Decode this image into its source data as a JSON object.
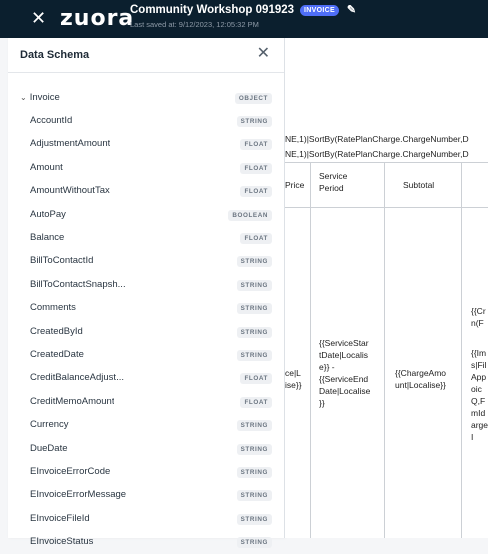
{
  "header": {
    "logo": "zuora",
    "title": "Community Workshop 091923",
    "badge": "INVOICE",
    "saved": "Last saved at: 9/12/2023, 12:05:32 PM"
  },
  "panel": {
    "title": "Data Schema",
    "root": {
      "label": "Invoice",
      "type": "OBJECT"
    },
    "fields": [
      {
        "label": "AccountId",
        "type": "STRING"
      },
      {
        "label": "AdjustmentAmount",
        "type": "FLOAT"
      },
      {
        "label": "Amount",
        "type": "FLOAT"
      },
      {
        "label": "AmountWithoutTax",
        "type": "FLOAT"
      },
      {
        "label": "AutoPay",
        "type": "BOOLEAN"
      },
      {
        "label": "Balance",
        "type": "FLOAT"
      },
      {
        "label": "BillToContactId",
        "type": "STRING"
      },
      {
        "label": "BillToContactSnapsh...",
        "type": "STRING"
      },
      {
        "label": "Comments",
        "type": "STRING"
      },
      {
        "label": "CreatedById",
        "type": "STRING"
      },
      {
        "label": "CreatedDate",
        "type": "STRING"
      },
      {
        "label": "CreditBalanceAdjust...",
        "type": "FLOAT"
      },
      {
        "label": "CreditMemoAmount",
        "type": "FLOAT"
      },
      {
        "label": "Currency",
        "type": "STRING"
      },
      {
        "label": "DueDate",
        "type": "STRING"
      },
      {
        "label": "EInvoiceErrorCode",
        "type": "STRING"
      },
      {
        "label": "EInvoiceErrorMessage",
        "type": "STRING"
      },
      {
        "label": "EInvoiceFileId",
        "type": "STRING"
      },
      {
        "label": "EInvoiceStatus",
        "type": "STRING"
      }
    ]
  },
  "document": {
    "formula1": "NE,1)|SortBy(RatePlanCharge.ChargeNumber,D",
    "formula2": "NE,1)|SortBy(RatePlanCharge.ChargeNumber,D",
    "col_price": "Price",
    "col_service": "Service\nPeriod",
    "col_subtotal": "Subtotal",
    "price_cell": "ce|L\nise}}",
    "service_cell": "{{ServiceStar\ntDate|Localis\ne}} -\n{{ServiceEnd\nDate|Localise\n}}",
    "subtotal_cell": "{{ChargeAmo\nunt|Localise}}",
    "right_cell_1": "{{Cr\nn(F",
    "right_cell_2": "{{Im\ns|Fil\nApp\noic\nQ,F\nmId\narge\nI"
  }
}
